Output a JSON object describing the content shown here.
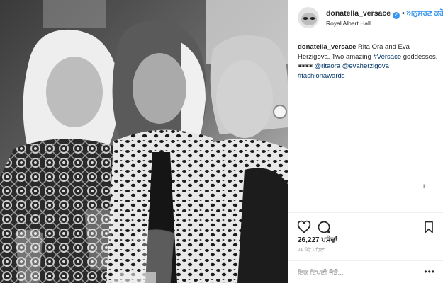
{
  "post": {
    "photo_alt": "",
    "author": {
      "username": "donatella_versace",
      "verified_icon": "verified-badge-icon",
      "follow_label": "ਅਨੁਸਰਣ ਕਰੋ",
      "location": "Royal Albert Hall"
    },
    "caption": {
      "username": "donatella_versace",
      "text_1": " Rita Ora and Eva Herzigova. Two amazing ",
      "hashtag_versace": "#Versace",
      "text_2": " goddesses. ",
      "emoji": "🕶🕶",
      "mention_1": "@ritaora",
      "mention_2": "@evaherzigova",
      "hashtag_awards": "#fashionawards"
    },
    "stray_char": "r",
    "actions": {
      "like_icon": "heart-icon",
      "comment_icon": "comment-bubble-icon",
      "save_icon": "bookmark-icon"
    },
    "likes_text": "26,227 ਪਸੰਦਾਂ",
    "time_text": "21 ਘੰਟੇ ਪਹਿਲਾਂ",
    "comment_placeholder": "ਇਕ ਟਿੱਪਣੀ ਜੋੜੋ...",
    "more_label": "•••"
  },
  "colors": {
    "link_blue": "#3897f0",
    "caption_link": "#003569",
    "text": "#262626",
    "muted": "#999999"
  }
}
